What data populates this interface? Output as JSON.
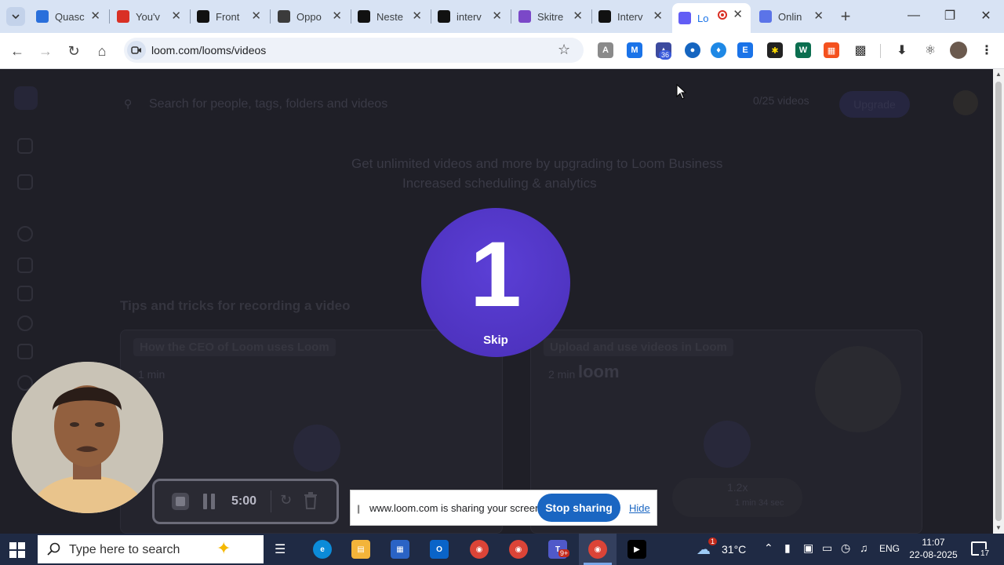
{
  "browser": {
    "tabs": [
      {
        "title": "Quasc",
        "icon": "quasar-icon",
        "color": "#2a6fdb"
      },
      {
        "title": "You'v",
        "icon": "gmail-icon",
        "color": "#d93025"
      },
      {
        "title": "Front",
        "icon": "codeform-icon",
        "color": "#111111"
      },
      {
        "title": "Oppo",
        "icon": "linkedin-icon",
        "color": "#3b3b3b"
      },
      {
        "title": "Neste",
        "icon": "codeform-icon",
        "color": "#111111"
      },
      {
        "title": "interv",
        "icon": "triangle-icon",
        "color": "#111111"
      },
      {
        "title": "Skitre",
        "icon": "skitrex-icon",
        "color": "#7b48c8"
      },
      {
        "title": "Interv",
        "icon": "triangle-icon",
        "color": "#111111"
      },
      {
        "title": "Lo",
        "icon": "loom-icon",
        "color": "#625df5",
        "active": true,
        "recording": true
      },
      {
        "title": "Onlin",
        "icon": "online-icon",
        "color": "#5b74e8"
      }
    ],
    "url": "loom.com/looms/videos"
  },
  "page": {
    "search_placeholder": "Search for people, tags, folders and videos",
    "video_count": "0/25 videos",
    "upgrade_label": "Upgrade",
    "banner_line1": "Get unlimited videos and more by upgrading to Loom Business",
    "banner_line2": "Increased scheduling & analytics",
    "tips_title": "Tips and tricks for recording a video",
    "card1_title": "How the CEO of Loom uses Loom",
    "card1_duration": "1 min",
    "card2_title": "Upload and use videos in Loom",
    "card2_duration": "2 min",
    "card2_logo": "loom",
    "card2_speed": "1.2x",
    "card2_saved": "1 min 34 sec"
  },
  "countdown": {
    "number": "1",
    "skip_label": "Skip"
  },
  "recorder": {
    "time": "5:00"
  },
  "share_bar": {
    "message": "www.loom.com is sharing your screen.",
    "stop_label": "Stop sharing",
    "hide_label": "Hide"
  },
  "taskbar": {
    "search_placeholder": "Type here to search",
    "teams_badge": "9+",
    "weather": "31°C",
    "weather_badge": "1",
    "language": "ENG",
    "time": "11:07",
    "date": "22-08-2025",
    "notification_count": "17"
  }
}
